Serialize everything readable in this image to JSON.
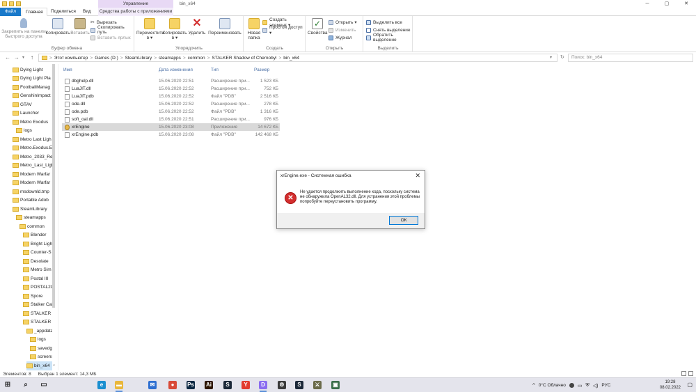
{
  "window": {
    "title": "bin_x64",
    "manage_tab": "Управление",
    "manage_sub": "Средства работы с приложениями",
    "controls": [
      "─",
      "▢",
      "✕"
    ]
  },
  "ribbon_tabs": [
    "Файл",
    "Главная",
    "Поделиться",
    "Вид"
  ],
  "ribbon": {
    "clipboard": {
      "title": "Буфер обмена",
      "pin": "Закрепить на панели быстрого доступа",
      "copy": "Копировать",
      "paste": "Вставить",
      "cut": "Вырезать",
      "copy_path": "Скопировать путь",
      "paste_shortcut": "Вставить ярлык"
    },
    "organize": {
      "title": "Упорядочить",
      "move_to": "Переместить в ▾",
      "copy_to": "Копировать в ▾",
      "delete": "Удалить",
      "rename": "Переименовать"
    },
    "new": {
      "title": "Создать",
      "new_folder": "Новая папка",
      "new_item": "Создать элемент ▾",
      "easy_access": "Простой доступ ▾"
    },
    "open": {
      "title": "Открыть",
      "properties": "Свойства",
      "open": "Открыть ▾",
      "edit": "Изменить",
      "history": "Журнал"
    },
    "select": {
      "title": "Выделить",
      "select_all": "Выделить все",
      "select_none": "Снять выделение",
      "invert": "Обратить выделение"
    }
  },
  "nav_buttons": [
    "←",
    "→",
    "▾",
    "↑"
  ],
  "address": {
    "crumbs": [
      "Этот компьютер",
      "Games (D:)",
      "SteamLibrary",
      "steamapps",
      "common",
      "STALKER Shadow of Chernobyl",
      "bin_x64"
    ],
    "separator": ">",
    "refresh": "↻",
    "dropdown": "▾"
  },
  "search": {
    "placeholder": "Поиск: bin_x64"
  },
  "tree": [
    {
      "label": "Dying Light",
      "level": 0
    },
    {
      "label": "Dying Light Pla",
      "level": 0
    },
    {
      "label": "FootballManag",
      "level": 0
    },
    {
      "label": "GenshinImpact",
      "level": 0
    },
    {
      "label": "GTAV",
      "level": 0
    },
    {
      "label": "Launcher",
      "level": 0
    },
    {
      "label": "Metro Exodus",
      "level": 0
    },
    {
      "label": "logs",
      "level": 1
    },
    {
      "label": "Metro Last Ligh",
      "level": 0
    },
    {
      "label": "Metro.Exodus.E",
      "level": 0
    },
    {
      "label": "Metro_2033_Re",
      "level": 0
    },
    {
      "label": "Metro_Last_Ligh",
      "level": 0
    },
    {
      "label": "Modern Warfar",
      "level": 0
    },
    {
      "label": "Modern Warfar",
      "level": 0
    },
    {
      "label": "msdownld.tmp",
      "level": 0
    },
    {
      "label": "Portable Adob",
      "level": 0
    },
    {
      "label": "SteamLibrary",
      "level": 0
    },
    {
      "label": "steamapps",
      "level": 1
    },
    {
      "label": "common",
      "level": 2
    },
    {
      "label": "Blender",
      "level": 3
    },
    {
      "label": "Bright Light",
      "level": 3
    },
    {
      "label": "Counter-S",
      "level": 3
    },
    {
      "label": "Desolate",
      "level": 3
    },
    {
      "label": "Metro Sim",
      "level": 3
    },
    {
      "label": "Postal III",
      "level": 3
    },
    {
      "label": "POSTAL2C",
      "level": 3
    },
    {
      "label": "Spore",
      "level": 3
    },
    {
      "label": "Stalker Cal",
      "level": 3
    },
    {
      "label": "STALKER C",
      "level": 3
    },
    {
      "label": "STALKER S",
      "level": 3
    },
    {
      "label": "_appdata",
      "level": 4
    },
    {
      "label": "logs",
      "level": 5
    },
    {
      "label": "savedg",
      "level": 5
    },
    {
      "label": "screens",
      "level": 5
    },
    {
      "label": "bin_x64",
      "level": 4,
      "selected": true
    }
  ],
  "columns": {
    "name": "Имя",
    "date": "Дата изменения",
    "type": "Тип",
    "size": "Размер"
  },
  "files": [
    {
      "name": "dbghelp.dll",
      "date": "15.06.2020 22:51",
      "type": "Расширение при...",
      "size": "1 523 КБ",
      "icon": "dll"
    },
    {
      "name": "LuaJIT.dll",
      "date": "15.06.2020 22:52",
      "type": "Расширение при...",
      "size": "752 КБ",
      "icon": "dll"
    },
    {
      "name": "LuaJIT.pdb",
      "date": "15.06.2020 22:52",
      "type": "Файл \"PDB\"",
      "size": "2 516 КБ",
      "icon": "pdb"
    },
    {
      "name": "ode.dll",
      "date": "15.06.2020 22:52",
      "type": "Расширение при...",
      "size": "278 КБ",
      "icon": "dll"
    },
    {
      "name": "ode.pdb",
      "date": "15.06.2020 22:52",
      "type": "Файл \"PDB\"",
      "size": "1 316 КБ",
      "icon": "pdb"
    },
    {
      "name": "soft_oal.dll",
      "date": "15.06.2020 22:51",
      "type": "Расширение при...",
      "size": "976 КБ",
      "icon": "dll"
    },
    {
      "name": "xrEngine",
      "date": "15.06.2020 23:08",
      "type": "Приложение",
      "size": "14 672 КБ",
      "icon": "exe",
      "selected": true
    },
    {
      "name": "xrEngine.pdb",
      "date": "15.06.2020 23:08",
      "type": "Файл \"PDB\"",
      "size": "142 468 КБ",
      "icon": "pdb"
    }
  ],
  "dialog": {
    "title": "xrEngine.exe - Системная ошибка",
    "close": "✕",
    "icon": "✕",
    "message": "Не удается продолжить выполнение кода, поскольку система не обнаружила OpenAL32.dll. Для устранения этой проблемы попробуйте переустановить программу.",
    "ok": "ОК"
  },
  "status": {
    "items": "Элементов: 8",
    "selected": "Выбран 1 элемент: 14,3 МБ"
  },
  "taskbar": {
    "weather": "0°C Облачно",
    "lang": "РУС",
    "time": "19:28",
    "date": "08.02.2022",
    "icons": [
      {
        "name": "start-icon",
        "glyph": "⊞",
        "color": "#2b2b2b"
      },
      {
        "name": "search-icon",
        "glyph": "⌕",
        "color": "#2b2b2b"
      },
      {
        "name": "task-view-icon",
        "glyph": "▭",
        "color": "#2b2b2b"
      },
      {
        "name": "edge-icon",
        "glyph": "e",
        "color": "#1b8fd0"
      },
      {
        "name": "explorer-icon",
        "glyph": "▬",
        "color": "#e9b73b"
      },
      {
        "name": "mail-icon",
        "glyph": "✉",
        "color": "#2e6fd1"
      },
      {
        "name": "chrome-icon",
        "glyph": "●",
        "color": "#d84a38"
      },
      {
        "name": "photoshop-icon",
        "glyph": "Ps",
        "color": "#0b2742"
      },
      {
        "name": "illustrator-icon",
        "glyph": "Ai",
        "color": "#2d1500"
      },
      {
        "name": "steam-icon",
        "glyph": "S",
        "color": "#1b2838"
      },
      {
        "name": "yandex-icon",
        "glyph": "Y",
        "color": "#e23b2e"
      },
      {
        "name": "discord-icon",
        "glyph": "D",
        "color": "#8a6cf0"
      },
      {
        "name": "settings-icon",
        "glyph": "⚙",
        "color": "#3a3a3a"
      },
      {
        "name": "steam2-icon",
        "glyph": "S",
        "color": "#1b2838"
      },
      {
        "name": "stalker-icon",
        "glyph": "⚔",
        "color": "#6b6b4a"
      },
      {
        "name": "app-icon",
        "glyph": "▣",
        "color": "#3a6e4a"
      }
    ]
  }
}
